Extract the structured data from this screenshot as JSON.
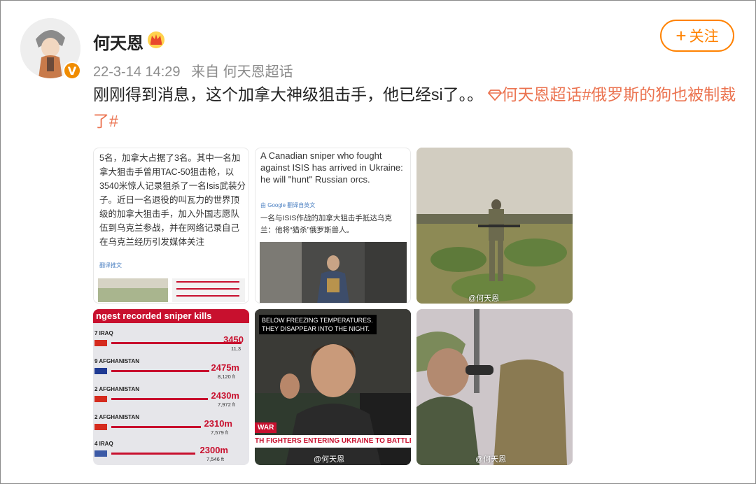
{
  "user": {
    "name": "何天恩",
    "date": "22-3-14 14:29",
    "source": "来自 何天恩超话",
    "verified_badge": "V",
    "crown_icon": "crown-icon"
  },
  "follow_button": {
    "label": "关注",
    "icon": "plus-icon"
  },
  "post": {
    "text": "刚刚得到消息，这个加拿大神级狙击手，他已经si了。。",
    "supertopic_icon": "diamond-icon",
    "supertopic": "何天恩超话",
    "hashtag": "#俄罗斯的狗也被制裁了#"
  },
  "images": {
    "img1": {
      "text": "5名，加拿大占据了3名。其中一名加拿大狙击手曾用TAC-50狙击枪，以3540米惊人记录狙杀了一名Isis武装分子。近日一名退役的叫瓦力的世界顶级的加拿大狙击手，加入外国志愿队伍到乌克兰参战，并在网络记录自己在乌克兰经历引发媒体关注",
      "translate": "翻译推文"
    },
    "img2": {
      "en": "A Canadian sniper who fought against ISIS has arrived in Ukraine: he will \"hunt\" Russian orcs.",
      "gtranslate": "由 Google 翻译自英文",
      "zh": "一名与ISIS作战的加拿大狙击手抵达乌克兰：他将“猎杀”俄罗斯兽人。"
    },
    "img3": {
      "watermark": "@何天恩"
    },
    "img4": {
      "title": "ngest recorded sniper kills",
      "rows": [
        {
          "label": "7 IRAQ",
          "dist": "3450",
          "ft": "11,3"
        },
        {
          "label": "9 AFGHANISTAN",
          "dist": "2475m",
          "ft": "8,120 ft"
        },
        {
          "label": "2 AFGHANISTAN",
          "dist": "2430m",
          "ft": "7,972 ft"
        },
        {
          "label": "2 AFGHANISTAN",
          "dist": "2310m",
          "ft": "7,579 ft"
        },
        {
          "label": "4 IRAQ",
          "dist": "2300m",
          "ft": "7,546 ft"
        }
      ]
    },
    "img5": {
      "caption": "BELOW FREEZING TEMPERATURES. THEY DISAPPEAR INTO THE NIGHT.",
      "war": "WAR",
      "ticker": "TH FIGHTERS ENTERING UKRAINE TO BATTLE THE RUS",
      "watermark": "@何天恩"
    },
    "img6": {
      "watermark": "@何天恩"
    }
  }
}
